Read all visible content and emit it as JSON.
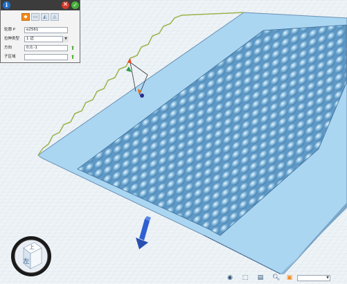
{
  "panel": {
    "title_icons": {
      "info": "i",
      "close": "✕",
      "confirm": "✓"
    },
    "mode_buttons": [
      "",
      "",
      "",
      ""
    ],
    "rows": [
      {
        "label": "轮廓 P",
        "value": "e2561"
      },
      {
        "label": "拉伸类型",
        "value": "1 边"
      },
      {
        "label": "方向",
        "value": "0,0,-1"
      },
      {
        "label": "子区域",
        "value": ""
      }
    ]
  },
  "view_cube": {
    "top_face": "上",
    "front_face": "左"
  },
  "toolbar": {
    "icons": [
      "eye-icon",
      "sketch-icon",
      "layers-icon",
      "zoom-icon",
      "render-icon"
    ],
    "zoom_value": ""
  },
  "colors": {
    "grid_bg": "#eef3f6",
    "surface": "#aad6f2",
    "accent": "#f28a1d",
    "arrow": "#2f5fd0"
  }
}
